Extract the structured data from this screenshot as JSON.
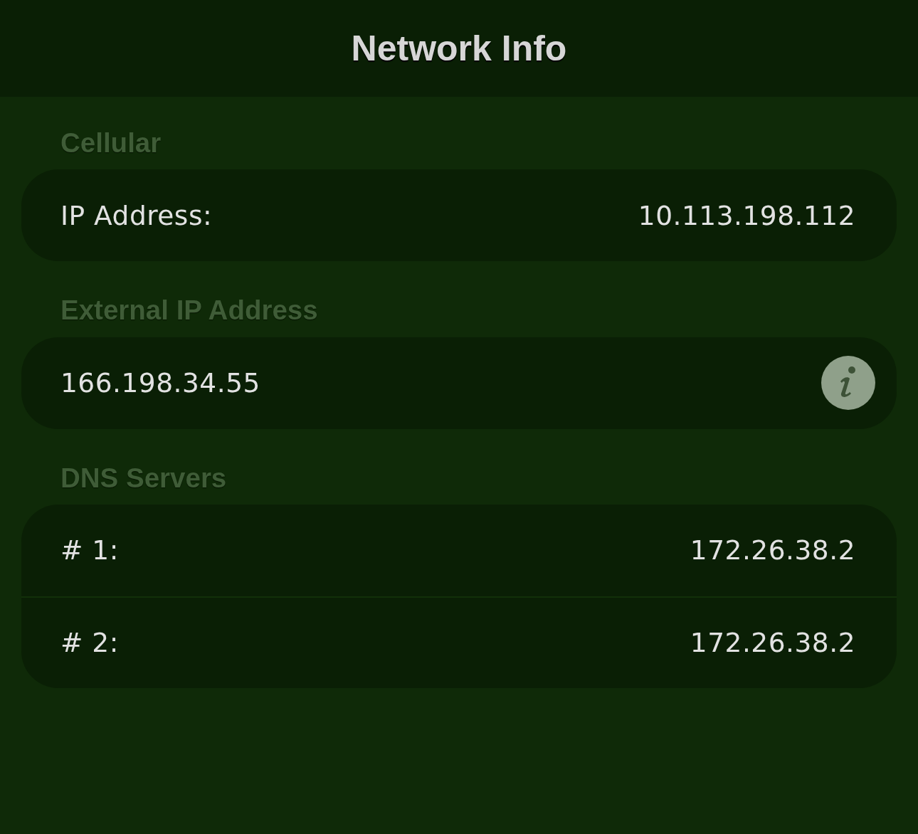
{
  "navigation_bar": {
    "title": "Network Info"
  },
  "sections": [
    {
      "header": "Cellular",
      "rows": [
        {
          "kind": "pair",
          "label": "IP Address:",
          "value": "10.113.198.112"
        }
      ]
    },
    {
      "header": "External IP Address",
      "rows": [
        {
          "kind": "info",
          "value": "166.198.34.55"
        }
      ]
    },
    {
      "header": "DNS Servers",
      "rows": [
        {
          "kind": "pair",
          "label": "# 1:",
          "value": "172.26.38.2"
        },
        {
          "kind": "pair",
          "label": "# 2:",
          "value": "172.26.38.2"
        }
      ]
    }
  ]
}
